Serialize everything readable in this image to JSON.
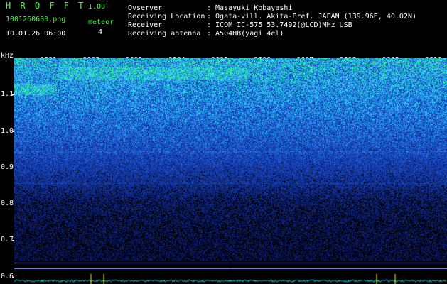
{
  "app": {
    "name": "H R O F F T",
    "version": "1.00",
    "file": "1001260600.png",
    "meteor_label": "meteor",
    "meteor_count": "4",
    "datetime": "10.01.26 06:00"
  },
  "info": {
    "observer_label": "Ovserver",
    "observer_value": ": Masayuki Kobayashi",
    "location_label": "Receiving Location",
    "location_value": ": Ogata-vill. Akita-Pref. JAPAN (139.96E, 40.02N)",
    "receiver_label": "Receiver",
    "receiver_value": ": ICOM IC-575 53.7492(@LCD)MHz USB",
    "antenna_label": "Receiving antenna",
    "antenna_value": ": A504HB(yagi 4el)"
  },
  "chart_data": {
    "type": "heatmap",
    "ylabel": "kHz",
    "yticks": [
      "1.1",
      "1.0",
      "0.9",
      "0.8",
      "0.7",
      "0.6"
    ],
    "ylim": [
      0.58,
      1.2
    ],
    "xticks": [
      "0601",
      "0602",
      "0603",
      "0604",
      "0605",
      "0606",
      "0607",
      "0608",
      "0609",
      "0610"
    ],
    "colors": {
      "noise_low": "#0a1a6e",
      "noise_mid": "#1e5adc",
      "noise_high": "#2ad8ff",
      "signal": "#3cff6c",
      "baseline": "#10c8d8",
      "meteor_spike": "#ffff00"
    }
  }
}
